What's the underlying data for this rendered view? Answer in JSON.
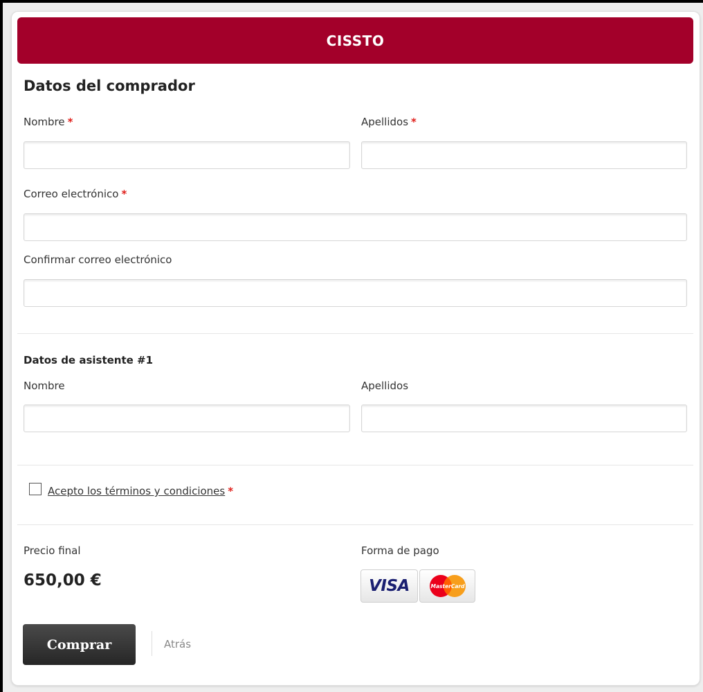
{
  "header": {
    "title": "CISSTO"
  },
  "buyer": {
    "title": "Datos del comprador",
    "first_name_label": "Nombre",
    "last_name_label": "Apellidos",
    "email_label": "Correo electrónico",
    "confirm_email_label": "Confirmar correo electrónico",
    "required_mark": "*",
    "first_name_value": "",
    "last_name_value": "",
    "email_value": "",
    "confirm_email_value": ""
  },
  "attendee": {
    "title": "Datos de asistente #1",
    "first_name_label": "Nombre",
    "last_name_label": "Apellidos",
    "first_name_value": "",
    "last_name_value": ""
  },
  "terms": {
    "link_text": "Acepto los términos y condiciones",
    "required_mark": "*",
    "checked": false
  },
  "payment": {
    "price_label": "Precio final",
    "price_value": "650,00 €",
    "method_label": "Forma de pago",
    "methods": [
      "VISA",
      "MasterCard"
    ]
  },
  "actions": {
    "buy_label": "Comprar",
    "back_label": "Atrás"
  },
  "colors": {
    "brand": "#a3002a",
    "required": "#e0201c",
    "button": "#333333",
    "visa": "#1a1f71",
    "mc_red": "#eb001b",
    "mc_orange": "#f79e1b"
  }
}
